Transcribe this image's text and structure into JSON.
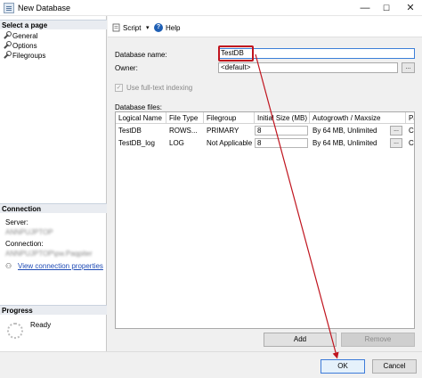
{
  "window": {
    "title": "New Database",
    "minimize": "—",
    "maximize": "☐",
    "close": "✕"
  },
  "sidebar": {
    "select_page_header": "Select a page",
    "pages": [
      {
        "label": "General"
      },
      {
        "label": "Options"
      },
      {
        "label": "Filegroups"
      }
    ],
    "connection_header": "Connection",
    "server_label": "Server:",
    "server_value": "ANNPUJPTOP",
    "connection_label": "Connection:",
    "connection_value": "ANNPUJPTOP\\pw.Paqpiter",
    "view_connection_link": "View connection properties",
    "progress_header": "Progress",
    "progress_status": "Ready"
  },
  "toolbar": {
    "script_label": "Script",
    "dropdown": "▾",
    "help_label": "Help",
    "help_glyph": "?"
  },
  "form": {
    "database_name_label": "Database name:",
    "database_name_value": "TestDB",
    "owner_label": "Owner:",
    "owner_value": "<default>",
    "owner_browse": "...",
    "fulltext_label": "Use full-text indexing",
    "fulltext_checked": "✓",
    "database_files_label": "Database files:"
  },
  "grid": {
    "columns": [
      "Logical Name",
      "File Type",
      "Filegroup",
      "Initial Size (MB)",
      "Autogrowth / Maxsize",
      "Pa"
    ],
    "rows": [
      {
        "logical_name": "TestDB",
        "file_type": "ROWS...",
        "filegroup": "PRIMARY",
        "initial_size": "8",
        "autogrowth": "By 64 MB, Unlimited",
        "path": "C:",
        "btn": "..."
      },
      {
        "logical_name": "TestDB_log",
        "file_type": "LOG",
        "filegroup": "Not Applicable",
        "initial_size": "8",
        "autogrowth": "By 64 MB, Unlimited",
        "path": "C:",
        "btn": "..."
      }
    ]
  },
  "buttons": {
    "add": "Add",
    "remove": "Remove",
    "ok": "OK",
    "cancel": "Cancel"
  },
  "colors": {
    "annotation": "#c0141e",
    "link": "#1f4bb5",
    "focus": "#3d7bd9"
  }
}
